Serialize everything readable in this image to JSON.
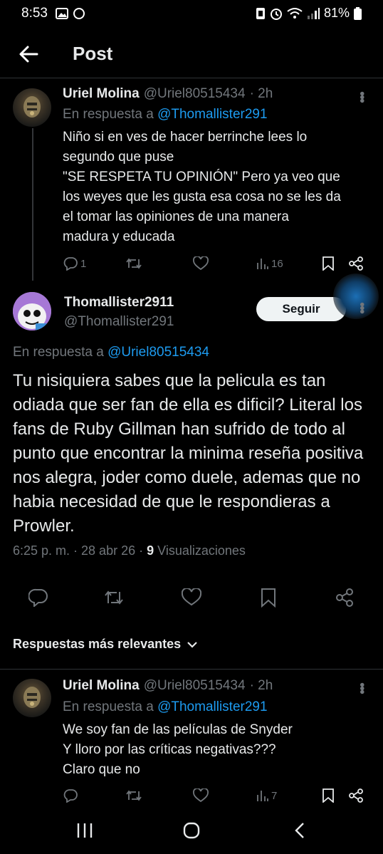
{
  "status_bar": {
    "time": "8:53",
    "battery": "81%"
  },
  "header": {
    "title": "Post"
  },
  "parent_tweet": {
    "name": "Uriel Molina",
    "handle": "@Uriel80515434",
    "time": "· 2h",
    "reply_prefix": "En respuesta a",
    "reply_to": "@Thomallister291",
    "text": "Niño si en ves de hacer berrinche lees lo\nsegundo que puse\n\"SE RESPETA TU OPINIÓN\" Pero ya veo que\nlos weyes que les gusta esa cosa no se les da\nel tomar las opiniones de una manera\nmadura y educada",
    "replies": "1",
    "views": "16"
  },
  "main_tweet": {
    "name": "Thomallister2911",
    "handle": "@Thomallister291",
    "follow_label": "Seguir",
    "reply_prefix": "En respuesta a",
    "reply_to": "@Uriel80515434",
    "text": "Tu nisiquiera sabes que la pelicula es tan odiada que ser fan de ella es dificil? Literal los fans de Ruby Gillman han sufrido de todo al punto que encontrar la minima reseña positiva nos alegra, joder como duele, ademas que no habia necesidad de que le respondieras a Prowler.",
    "timestamp": "6:25 p. m. · 28 abr 26 ·",
    "views_count": "9",
    "views_label": "Visualizaciones"
  },
  "sort": {
    "label": "Respuestas más relevantes"
  },
  "reply_tweet": {
    "name": "Uriel Molina",
    "handle": "@Uriel80515434",
    "time": "· 2h",
    "reply_prefix": "En respuesta a",
    "reply_to": "@Thomallister291",
    "text": "We soy fan de las películas de Snyder\nY lloro por las críticas negativas???\nClaro que no",
    "views": "7"
  }
}
